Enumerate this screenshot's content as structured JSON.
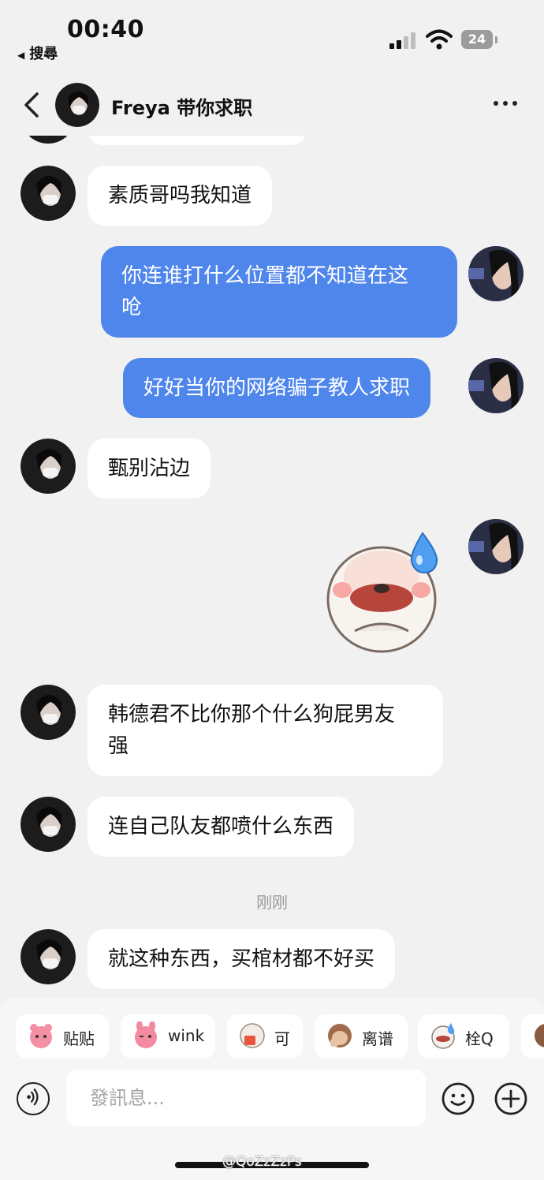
{
  "status_bar": {
    "time": "00:40",
    "back_app": "搜尋",
    "battery": "24"
  },
  "header": {
    "title": "Freya 带你求职"
  },
  "messages": [
    {
      "side": "in",
      "type": "text",
      "text": "素质哥吗我知道"
    },
    {
      "side": "out",
      "type": "text",
      "text": "你连谁打什么位置都不知道在这\n呛"
    },
    {
      "side": "out",
      "type": "text",
      "text": "好好当你的网络骗子教人求职"
    },
    {
      "side": "in",
      "type": "text",
      "text": "甄别沾边"
    },
    {
      "side": "out",
      "type": "sticker",
      "sticker": "sweat-drop-sticker"
    },
    {
      "side": "in",
      "type": "text",
      "text": "韩德君不比你那个什么狗屁男友\n强"
    },
    {
      "side": "in",
      "type": "text",
      "text": "连自己队友都喷什么东西"
    },
    {
      "side": "in",
      "type": "text",
      "text": "就这种东西，买棺材都不好买"
    }
  ],
  "time_separator": "刚刚",
  "quick_replies": [
    {
      "label": "贴贴",
      "icon": "hug-sticker-icon"
    },
    {
      "label": "wink",
      "icon": "wink-sticker-icon"
    },
    {
      "label": "可",
      "icon": "ok-sticker-icon"
    },
    {
      "label": "离谱",
      "icon": "facepalm-sticker-icon"
    },
    {
      "label": "栓Q",
      "icon": "sweat-sticker-icon"
    }
  ],
  "input": {
    "placeholder": "發訊息..."
  },
  "watermark": "@QoZzZzPs",
  "colors": {
    "outgoing_bubble": "#4f86ec",
    "incoming_bubble": "#ffffff",
    "background": "#f1f1f1"
  }
}
